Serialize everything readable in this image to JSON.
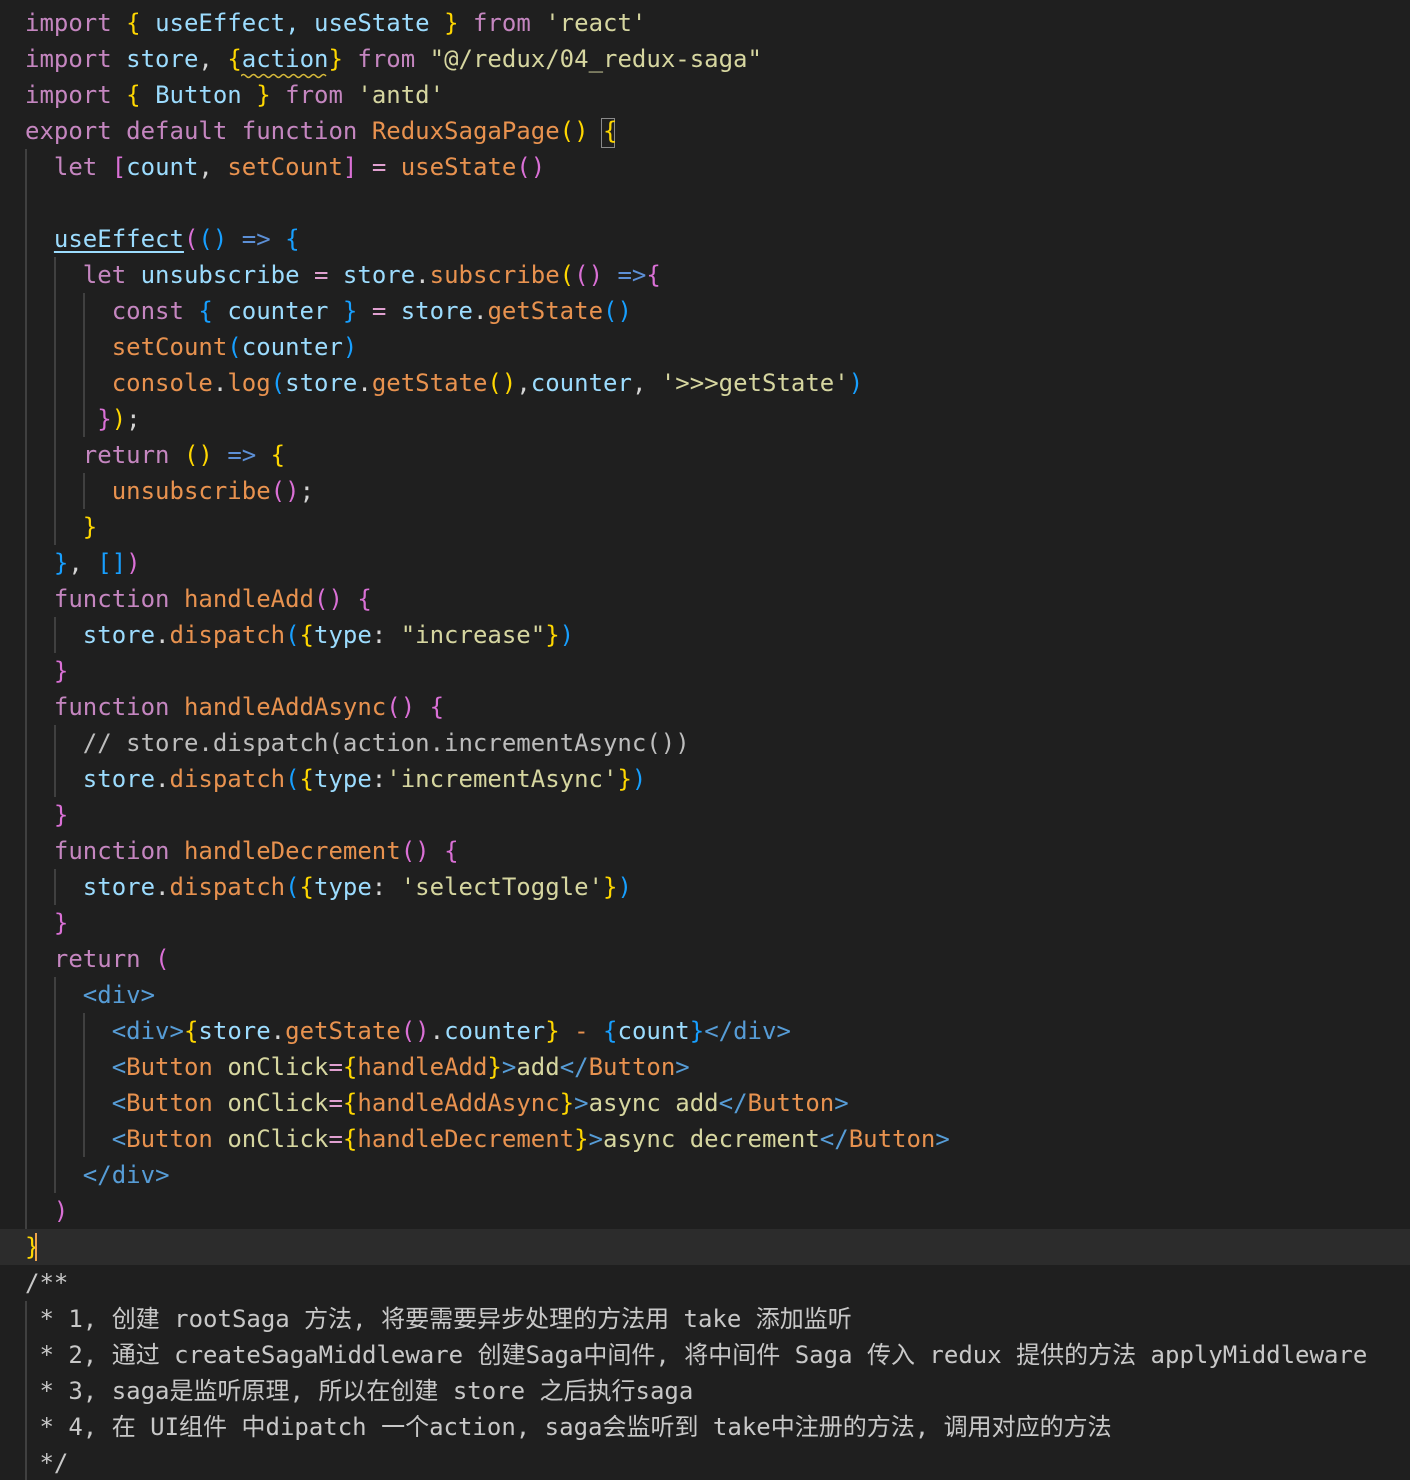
{
  "editor": {
    "imports": {
      "kw_import": "import",
      "kw_from": "from",
      "react_names": "useEffect, useState",
      "react_source": "'react'",
      "store_name": "store",
      "action_name": "action",
      "store_source": "\"@/redux/04_redux-saga\"",
      "antd_names": "Button",
      "antd_source": "'antd'"
    },
    "component": {
      "kw_export": "export",
      "kw_default": "default",
      "kw_function": "function",
      "name": "ReduxSagaPage",
      "kw_let": "let",
      "kw_const": "const",
      "kw_return": "return",
      "count": "count",
      "set_count": "setCount",
      "use_state": "useState",
      "use_effect": "useEffect",
      "unsubscribe": "unsubscribe",
      "store": "store",
      "subscribe": "subscribe",
      "counter": "counter",
      "get_state": "getState",
      "console": "console",
      "log": "log",
      "log_label": "'>>>getState'",
      "handle_add": "handleAdd",
      "handle_add_async": "handleAddAsync",
      "handle_decrement": "handleDecrement",
      "dispatch": "dispatch",
      "type_key": "type",
      "type_increase": "\"increase\"",
      "type_increment_async": "'incrementAsync'",
      "type_select_toggle": "'selectToggle'",
      "commented_line": "// store.dispatch(action.incrementAsync())",
      "tag_div": "div",
      "tag_button": "Button",
      "on_click": "onClick",
      "text_add": "add",
      "text_async_add": "async add",
      "text_async_decrement_a": "async",
      "text_async_decrement_b": "decrement"
    },
    "doc_comment": {
      "open": "/**",
      "line1": " * 1, 创建 rootSaga 方法, 将要需要异步处理的方法用 take 添加监听",
      "line2": " * 2, 通过 createSagaMiddleware 创建Saga中间件, 将中间件 Saga 传入 redux 提供的方法 applyMiddleware",
      "line3": " * 3, saga是监听原理, 所以在创建 store 之后执行saga",
      "line4": " * 4, 在 UI组件 中dipatch 一个action, saga会监听到 take中注册的方法, 调用对应的方法",
      "close": " */"
    },
    "colors": {
      "background": "#1f1f1f",
      "keyword": "#c586c0",
      "function_name": "#e8924f",
      "identifier": "#9cdcfe",
      "string": "#d6d6a0",
      "bracket_level1": "#ffd700",
      "bracket_level2": "#da70d6",
      "bracket_level3": "#179fff",
      "cursor": "#f0a64c"
    }
  }
}
